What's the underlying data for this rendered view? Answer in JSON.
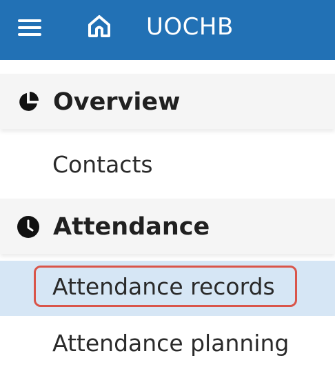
{
  "topbar": {
    "menu_icon": "hamburger-menu-icon",
    "home_icon": "home-icon",
    "title": "UOCHB"
  },
  "sections": [
    {
      "label": "Overview",
      "icon": "pie-chart-icon",
      "items": [
        {
          "label": "Contacts"
        }
      ]
    },
    {
      "label": "Attendance",
      "icon": "clock-icon",
      "items": [
        {
          "label": "Attendance records",
          "selected": true
        },
        {
          "label": "Attendance planning"
        }
      ]
    }
  ],
  "colors": {
    "topbar_bg": "#2271b5",
    "section_bg": "#f5f5f5",
    "selected_bg": "#d6e6f5",
    "highlight_border": "#d9554a"
  }
}
